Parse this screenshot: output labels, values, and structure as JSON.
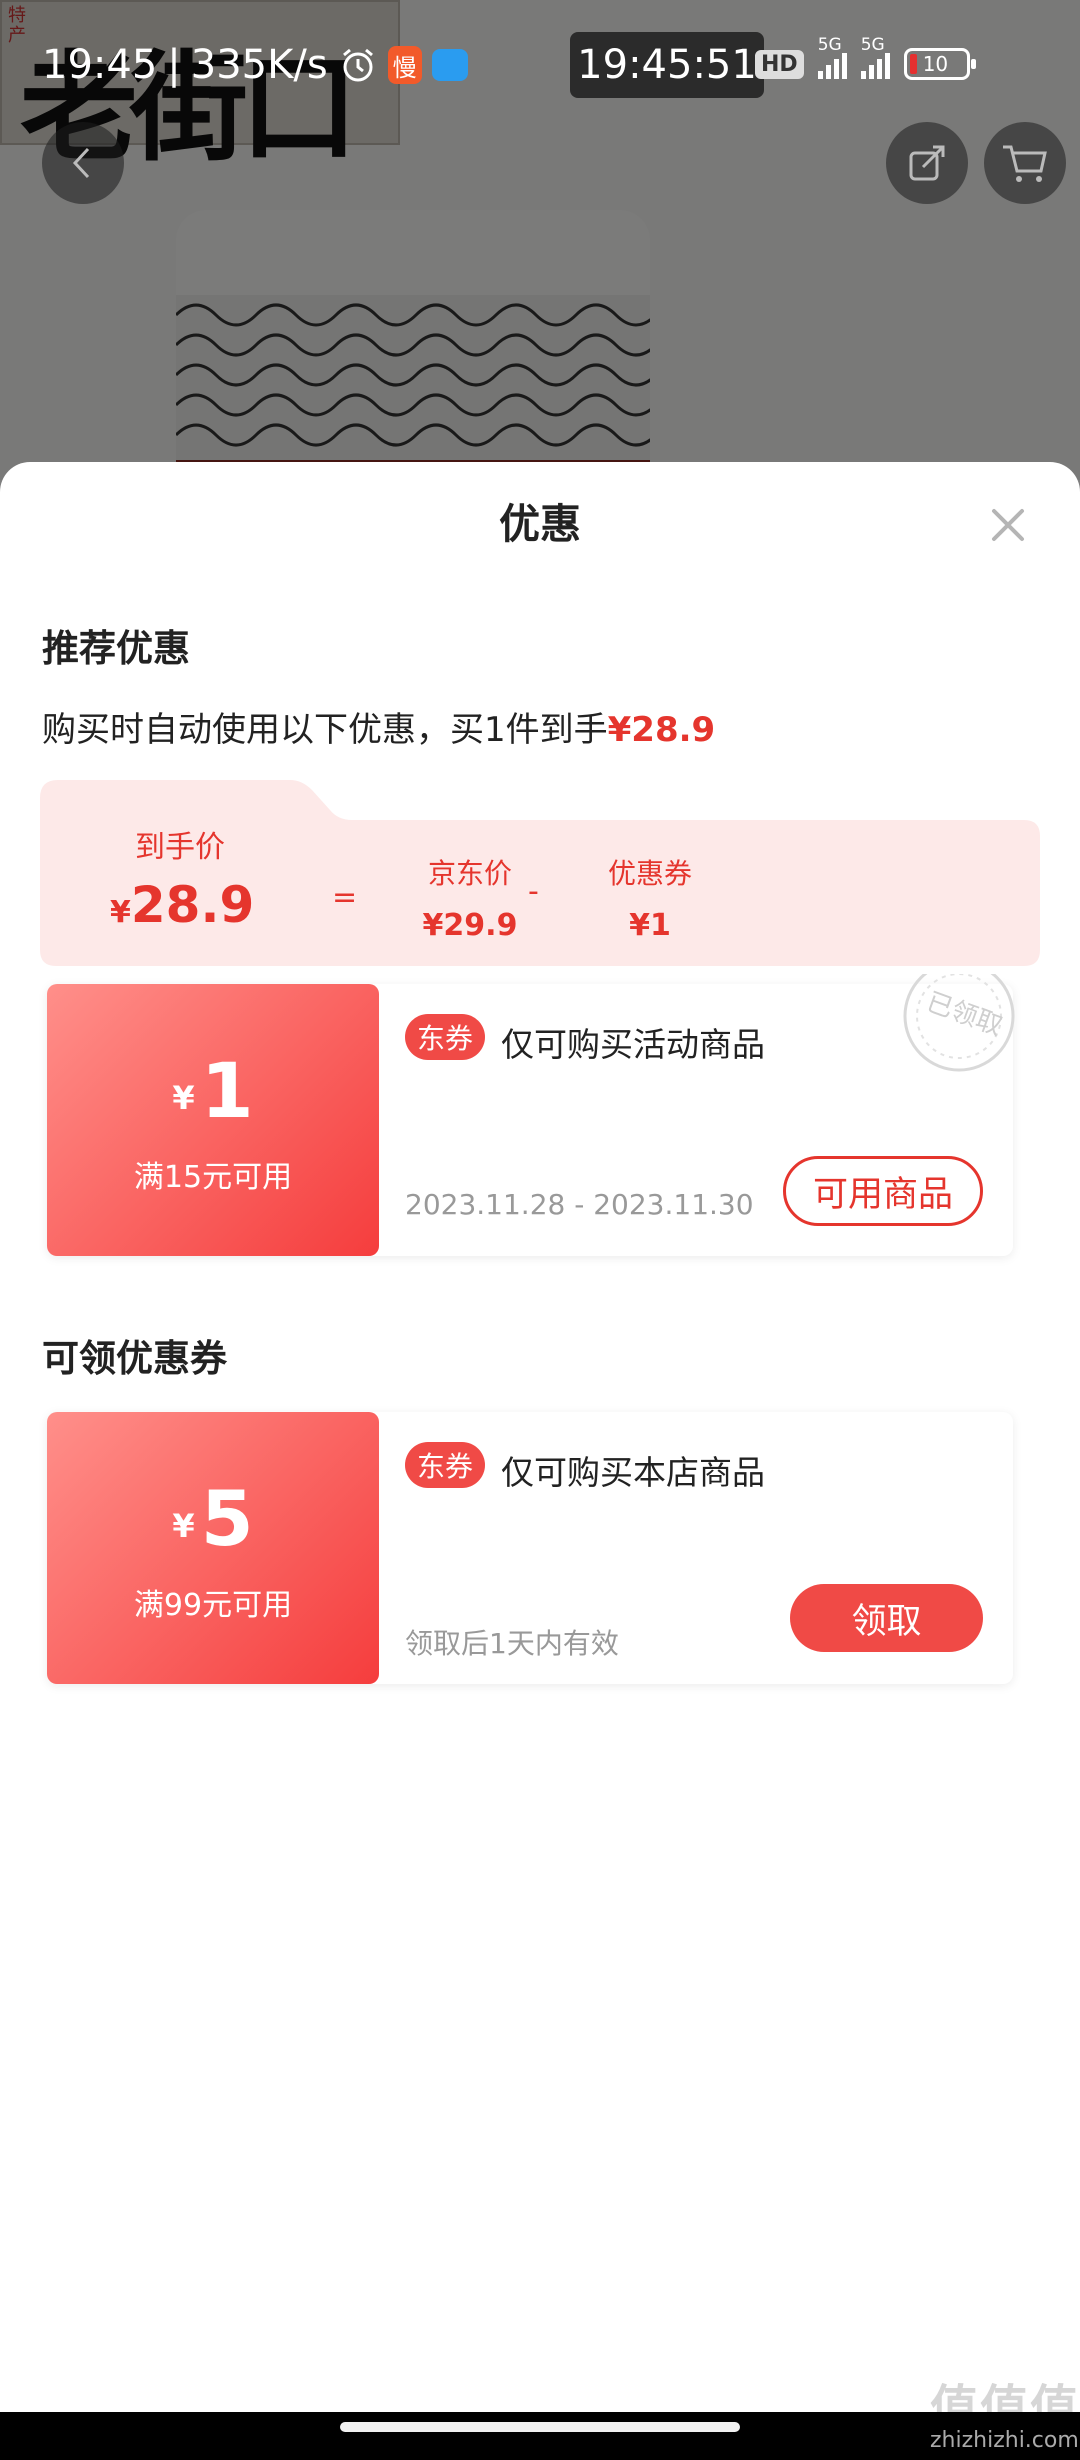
{
  "status_bar": {
    "time": "19:45",
    "speed": "335K/s",
    "app_badge": "慢",
    "clock": "19:45:51",
    "hd": "HD",
    "signal1": "5G",
    "signal2": "5G",
    "battery": "10"
  },
  "background": {
    "sign_text": "老街口"
  },
  "sheet": {
    "title": "优惠",
    "recommend_title": "推荐优惠",
    "desc_prefix": "购买时自动使用以下优惠，买1件到手",
    "desc_price": "¥28.9",
    "breakdown": {
      "final_label": "到手价",
      "final_yen": "¥",
      "final_value": "28.9",
      "equals": "=",
      "jd_label": "京东价",
      "jd_value": "¥29.9",
      "minus": "-",
      "coupon_label": "优惠券",
      "coupon_value": "¥1"
    },
    "applied_coupon": {
      "yen": "¥",
      "amount": "1",
      "condition": "满15元可用",
      "tag": "东券",
      "title": "仅可购买活动商品",
      "date": "2023.11.28 - 2023.11.30",
      "button": "可用商品",
      "stamp": "已领取"
    },
    "claim_title": "可领优惠券",
    "claim_coupon": {
      "yen": "¥",
      "amount": "5",
      "condition": "满99元可用",
      "tag": "东券",
      "title": "仅可购买本店商品",
      "validity": "领取后1天内有效",
      "button": "领取"
    }
  },
  "watermark": {
    "main": "值值值",
    "sub": "zhizhizhi.com"
  },
  "colors": {
    "accent": "#e5352d",
    "coupon_gradient_start": "#ff8f8a",
    "coupon_gradient_end": "#f53d3d",
    "breakdown_bg": "#fde9e8"
  }
}
